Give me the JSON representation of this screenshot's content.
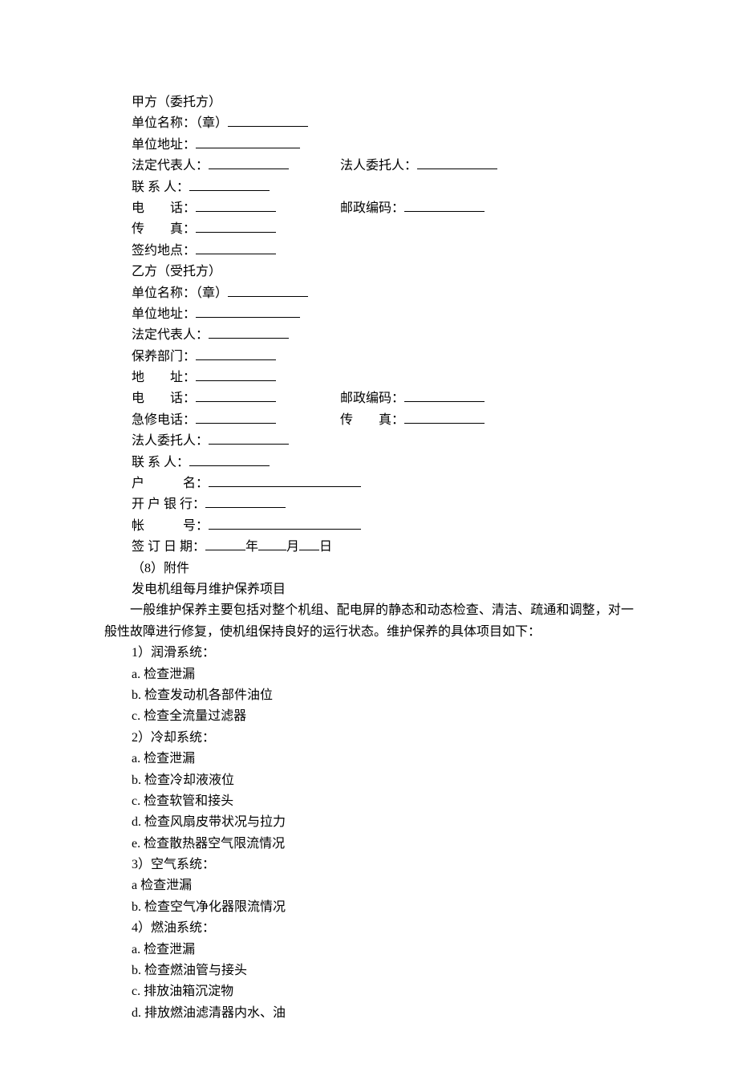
{
  "partyA": {
    "header": "甲方（委托方）",
    "companyName": "单位名称：（章）",
    "address": "单位地址：",
    "legalRep": "法定代表人：",
    "legalEntrust": "法人委托人：",
    "contact": "联 系 人：",
    "phone": "电　　话：",
    "postalCode": "邮政编码：",
    "fax": "传　　真：",
    "signLocation": "签约地点："
  },
  "partyB": {
    "header": "乙方（受托方）",
    "companyName": "单位名称：（章）",
    "address": "单位地址：",
    "legalRep": "法定代表人：",
    "maintenanceDept": "保养部门：",
    "deptAddress": "地　　址：",
    "phone": "电　　话：",
    "postalCode": "邮政编码：",
    "emergencyPhone": "急修电话：",
    "fax": "传　　真：",
    "legalEntrust": "法人委托人：",
    "contact": "联 系 人：",
    "accountName": "户　　　名：",
    "bank": "开 户 银 行：",
    "accountNumber": "帐　　　号：",
    "signDate": "签 订 日 期：",
    "year": "年",
    "month": "月",
    "day": "日"
  },
  "attachment": {
    "header": "（8）附件",
    "title": "发电机组每月维护保养项目",
    "description": "一般维护保养主要包括对整个机组、配电屏的静态和动态检查、清洁、疏通和调整，对一般性故障进行修复，使机组保持良好的运行状态。维护保养的具体项目如下："
  },
  "sections": {
    "lubrication": {
      "title": "1）润滑系统：",
      "items": {
        "a": "a. 检查泄漏",
        "b": "b. 检查发动机各部件油位",
        "c": "c. 检查全流量过滤器"
      }
    },
    "cooling": {
      "title": "2）冷却系统：",
      "items": {
        "a": "a. 检查泄漏",
        "b": "b. 检查冷却液液位",
        "c": "c. 检查软管和接头",
        "d": "d. 检查风扇皮带状况与拉力",
        "e": "e. 检查散热器空气限流情况"
      }
    },
    "air": {
      "title": "3）空气系统：",
      "items": {
        "a": "a 检查泄漏",
        "b": "b. 检查空气净化器限流情况"
      }
    },
    "fuel": {
      "title": "4）燃油系统：",
      "items": {
        "a": "a. 检查泄漏",
        "b": "b. 检查燃油管与接头",
        "c": "c. 排放油箱沉淀物",
        "d": "d. 排放燃油滤清器内水、油"
      }
    }
  }
}
